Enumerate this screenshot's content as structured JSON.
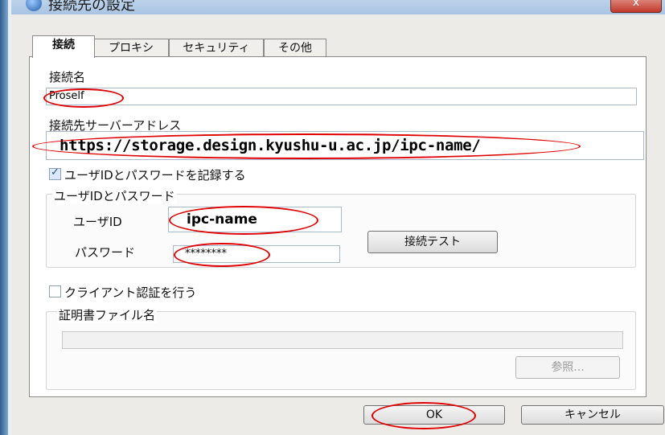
{
  "window": {
    "title": "接続先の設定",
    "close_label": "x"
  },
  "tabs": [
    {
      "label": "接続"
    },
    {
      "label": "プロキシ"
    },
    {
      "label": "セキュリティ"
    },
    {
      "label": "その他"
    }
  ],
  "connection_name": {
    "label": "接続名",
    "value": "Proself"
  },
  "server_address": {
    "label": "接続先サーバーアドレス",
    "value": "https://storage.design.kyushu-u.ac.jp/ipc-name/"
  },
  "save_credentials": {
    "label": "ユーザIDとパスワードを記録する",
    "checked": true
  },
  "credentials_group": {
    "title": "ユーザIDとパスワード",
    "user_id_label": "ユーザID",
    "user_id_value": "ipc-name",
    "password_label": "パスワード",
    "password_value": "********",
    "test_button": "接続テスト"
  },
  "client_auth": {
    "label": "クライアント認証を行う",
    "checked": false
  },
  "cert_group": {
    "title": "証明書ファイル名",
    "file_value": "",
    "browse_button": "参照..."
  },
  "footer": {
    "ok_label": "OK",
    "cancel_label": "キャンセル"
  },
  "colors": {
    "annotation": "#e00000",
    "title_bar": "#a9c4e2"
  }
}
